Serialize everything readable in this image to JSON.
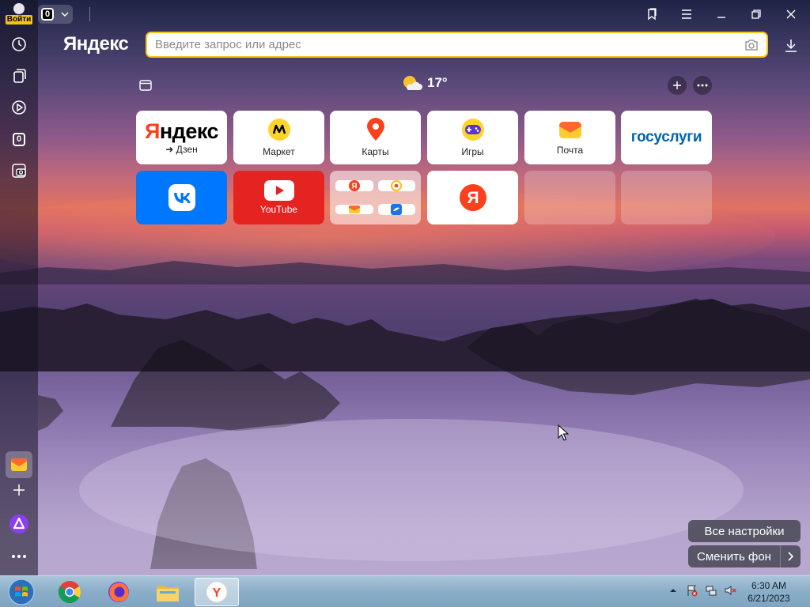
{
  "browser": {
    "login_label": "Войти",
    "tab_count": "0",
    "brand": "Яндекс",
    "omnibox": {
      "placeholder": "Введите запрос или адрес",
      "value": ""
    }
  },
  "sidebar": {
    "items": [
      {
        "icon": "history-icon"
      },
      {
        "icon": "collections-icon"
      },
      {
        "icon": "video-play-icon"
      },
      {
        "icon": "tabs-counter-icon",
        "label": "0"
      },
      {
        "icon": "screenshot-camera-icon"
      },
      {
        "icon": "mail-icon"
      },
      {
        "icon": "add-icon"
      },
      {
        "icon": "alice-icon"
      },
      {
        "icon": "more-icon"
      }
    ]
  },
  "newtab": {
    "weather": {
      "temperature": "17°"
    },
    "tiles": [
      {
        "logo": "Яндекс",
        "label": "➜ Дзен"
      },
      {
        "label": "Маркет"
      },
      {
        "label": "Карты"
      },
      {
        "label": "Игры"
      },
      {
        "label": "Почта"
      },
      {
        "logo": "госуслуги"
      },
      {
        "label": ""
      },
      {
        "label": "YouTube"
      },
      {
        "label": ""
      },
      {
        "label": ""
      },
      {
        "label": ""
      },
      {
        "label": ""
      }
    ],
    "all_settings": "Все настройки",
    "change_bg": "Сменить фон"
  },
  "taskbar": {
    "apps": [
      "start-orb",
      "chrome",
      "firefox",
      "explorer",
      "yandex-browser"
    ],
    "time": "6:30 AM",
    "date": "6/21/2023"
  },
  "colors": {
    "accent": "#f4c619",
    "vk": "#0077ff",
    "youtube": "#e52421",
    "yandex_red": "#fc3f1d"
  }
}
